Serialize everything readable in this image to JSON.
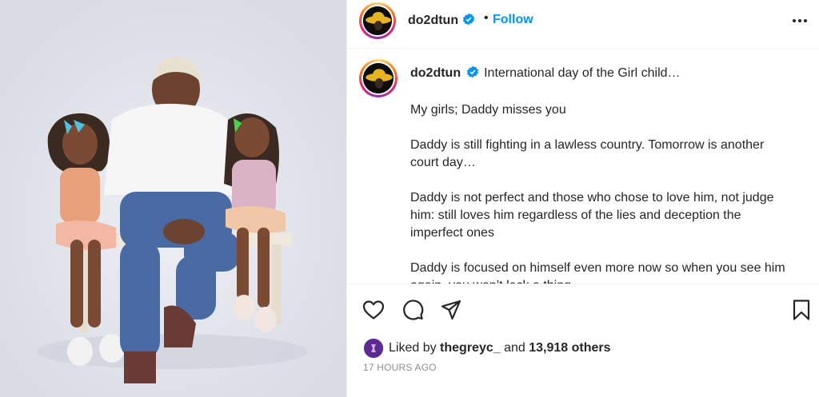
{
  "post": {
    "username": "do2dtun",
    "follow_label": "Follow",
    "separator": "•"
  },
  "caption": {
    "username": "do2dtun",
    "first_line": "International day of the Girl child…",
    "paragraphs": [
      "My girls; Daddy misses you",
      "Daddy is still fighting in a lawless country. Tomorrow is another court day…",
      "Daddy is not perfect and those who chose to love him, not judge him: still loves him regardless of the lies and deception the imperfect ones",
      "Daddy is focused on himself even more now so when you see him again, you won’t lack a thing"
    ]
  },
  "likes": {
    "prefix": "Liked by",
    "liker": "thegreyc_",
    "joiner": "and",
    "count": "13,918 others"
  },
  "timestamp": "17 HOURS AGO",
  "icons": {
    "like": "heart-icon",
    "comment": "comment-icon",
    "share": "share-icon",
    "save": "bookmark-icon",
    "more": "more-options-icon",
    "verified": "verified-badge-icon"
  },
  "colors": {
    "follow": "#0095f6",
    "verified": "#0095f6",
    "timestamp": "#8e8e8e"
  }
}
